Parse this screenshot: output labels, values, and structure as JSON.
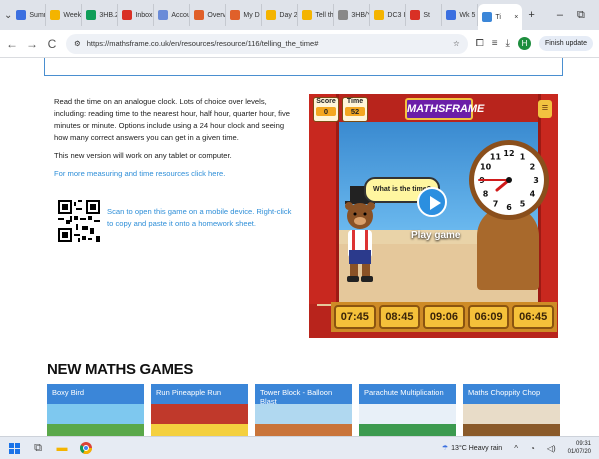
{
  "tabs": [
    {
      "label": "Summ",
      "color": "#3b6fe0"
    },
    {
      "label": "Week",
      "color": "#f4b400"
    },
    {
      "label": "3HB.2",
      "color": "#0f9d58"
    },
    {
      "label": "Inbox",
      "color": "#d93025"
    },
    {
      "label": "Accou",
      "color": "#6a8bd8"
    },
    {
      "label": "Overv",
      "color": "#e0602a"
    },
    {
      "label": "My D",
      "color": "#e0602a"
    },
    {
      "label": "Day 2",
      "color": "#f4b400"
    },
    {
      "label": "Tell th",
      "color": "#f4b400"
    },
    {
      "label": "3HB/Y",
      "color": "#888888"
    },
    {
      "label": "DC3 I",
      "color": "#f4b400"
    },
    {
      "label": "St",
      "color": "#d93025"
    },
    {
      "label": "Wk 5",
      "color": "#3b6fe0"
    },
    {
      "label": "Ti",
      "color": "#3b86d8",
      "active": true
    }
  ],
  "window_controls": {
    "new_tab": "+",
    "minimize": "–",
    "restore": "⧉"
  },
  "address": {
    "url": "https://mathsframe.co.uk/en/resources/resource/116/telling_the_time#",
    "profile_initial": "H",
    "finish_update": "Finish update"
  },
  "description": {
    "p1": "Read the time on an analogue clock. Lots of choice over levels, including: reading time to the nearest hour, half hour, quarter hour, five minutes or minute. Options include using a 24 hour clock and seeing how many correct answers you can get in a given time.",
    "p2": "This new version will work on any tablet or computer.",
    "link": "For more measuring and time resources click here.",
    "qr_text": "Scan to open this game on a mobile device. Right-click to copy and paste it onto a homework sheet."
  },
  "game": {
    "score_label": "Score",
    "score_value": "0",
    "time_label": "Time",
    "time_value": "52",
    "logo": "MATHSFRAME",
    "prompt": "What is the time?",
    "play_label": "Play game",
    "answers": [
      "07:45",
      "08:45",
      "09:06",
      "06:09",
      "06:45"
    ],
    "clock_numbers": [
      "12",
      "1",
      "2",
      "3",
      "4",
      "5",
      "6",
      "7",
      "8",
      "9",
      "10",
      "11"
    ]
  },
  "new_games": {
    "heading": "NEW MATHS GAMES",
    "cards": [
      {
        "title": "Boxy Bird"
      },
      {
        "title": "Run Pineapple Run"
      },
      {
        "title": "Tower Block - Balloon Blast"
      },
      {
        "title": "Parachute Multiplication"
      },
      {
        "title": "Maths Choppity Chop"
      }
    ]
  },
  "taskbar": {
    "weather": "13°C  Heavy rain",
    "time": "09:31",
    "date": "01/07/20"
  }
}
